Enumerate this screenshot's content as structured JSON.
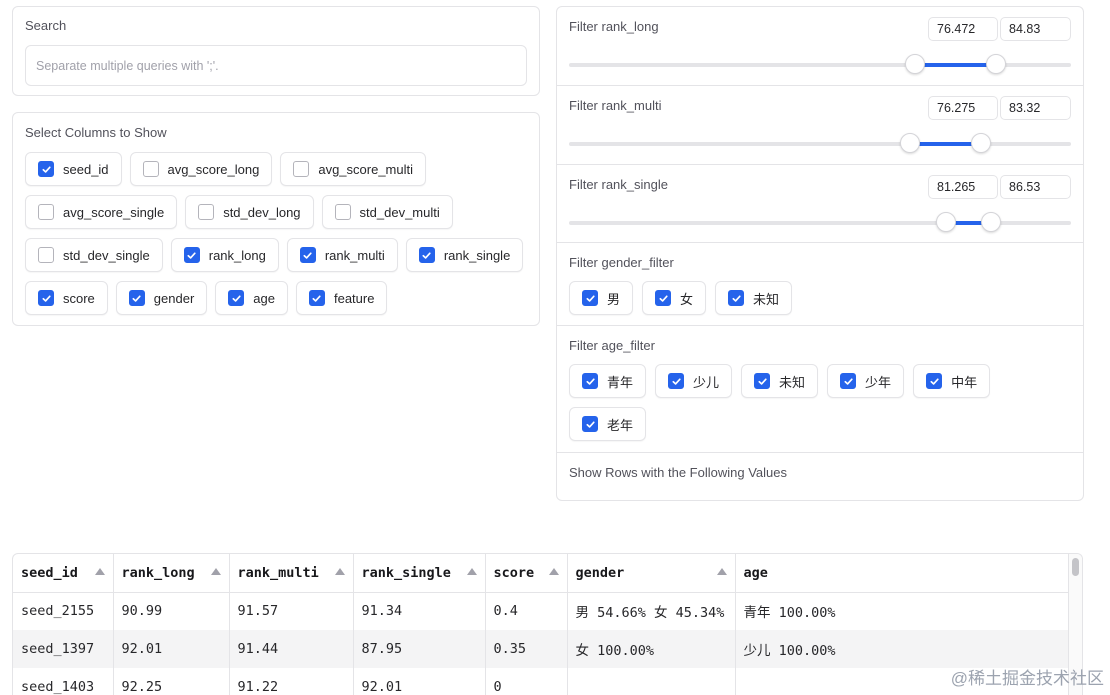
{
  "search": {
    "label": "Search",
    "placeholder": "Separate multiple queries with ';'.",
    "value": ""
  },
  "columns": {
    "label": "Select Columns to Show",
    "items": [
      {
        "label": "seed_id",
        "checked": true
      },
      {
        "label": "avg_score_long",
        "checked": false
      },
      {
        "label": "avg_score_multi",
        "checked": false
      },
      {
        "label": "avg_score_single",
        "checked": false
      },
      {
        "label": "std_dev_long",
        "checked": false
      },
      {
        "label": "std_dev_multi",
        "checked": false
      },
      {
        "label": "std_dev_single",
        "checked": false
      },
      {
        "label": "rank_long",
        "checked": true
      },
      {
        "label": "rank_multi",
        "checked": true
      },
      {
        "label": "rank_single",
        "checked": true
      },
      {
        "label": "score",
        "checked": true
      },
      {
        "label": "gender",
        "checked": true
      },
      {
        "label": "age",
        "checked": true
      },
      {
        "label": "feature",
        "checked": true
      }
    ]
  },
  "filters": {
    "rank_long": {
      "label": "Filter rank_long",
      "min": "76.472",
      "max": "84.83",
      "lo_frac": 0.69,
      "hi_frac": 0.85
    },
    "rank_multi": {
      "label": "Filter rank_multi",
      "min": "76.275",
      "max": "83.32",
      "lo_frac": 0.68,
      "hi_frac": 0.82
    },
    "rank_single": {
      "label": "Filter rank_single",
      "min": "81.265",
      "max": "86.53",
      "lo_frac": 0.75,
      "hi_frac": 0.84
    },
    "gender": {
      "label": "Filter gender_filter",
      "options": [
        {
          "label": "男",
          "checked": true
        },
        {
          "label": "女",
          "checked": true
        },
        {
          "label": "未知",
          "checked": true
        }
      ]
    },
    "age": {
      "label": "Filter age_filter",
      "options": [
        {
          "label": "青年",
          "checked": true
        },
        {
          "label": "少儿",
          "checked": true
        },
        {
          "label": "未知",
          "checked": true
        },
        {
          "label": "少年",
          "checked": true
        },
        {
          "label": "中年",
          "checked": true
        },
        {
          "label": "老年",
          "checked": true
        }
      ]
    },
    "show_rows_label": "Show Rows with the Following Values"
  },
  "table": {
    "headers": [
      "seed_id",
      "rank_long",
      "rank_multi",
      "rank_single",
      "score",
      "gender",
      "age"
    ],
    "sortable": [
      true,
      true,
      true,
      true,
      true,
      true,
      false
    ],
    "rows": [
      [
        "seed_2155",
        "90.99",
        "91.57",
        "91.34",
        "0.4",
        "男 54.66% 女 45.34%",
        "青年 100.00%"
      ],
      [
        "seed_1397",
        "92.01",
        "91.44",
        "87.95",
        "0.35",
        "女 100.00%",
        "少儿 100.00%"
      ],
      [
        "seed_1403",
        "92.25",
        "91.22",
        "92.01",
        "0",
        "",
        ""
      ]
    ]
  },
  "watermark": "@稀土掘金技术社区",
  "colors": {
    "accent": "#2563eb"
  }
}
